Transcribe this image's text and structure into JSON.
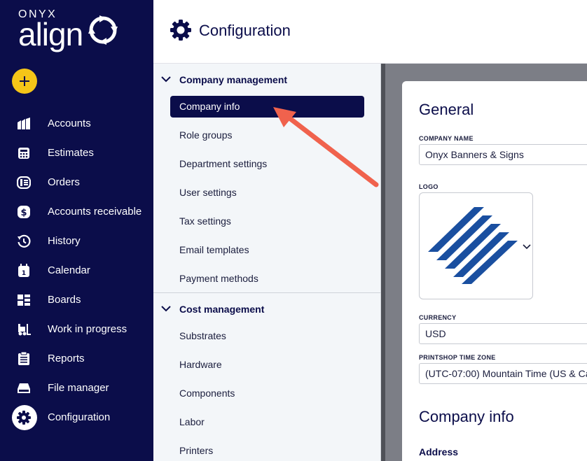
{
  "brand": {
    "onyx": "ONYX",
    "align": "align"
  },
  "sidebar": {
    "add_icon": "plus-icon",
    "items": [
      {
        "label": "Accounts",
        "icon": "accounts-icon"
      },
      {
        "label": "Estimates",
        "icon": "calculator-icon"
      },
      {
        "label": "Orders",
        "icon": "orders-icon"
      },
      {
        "label": "Accounts receivable",
        "icon": "dollar-icon"
      },
      {
        "label": "History",
        "icon": "history-icon"
      },
      {
        "label": "Calendar",
        "icon": "calendar-icon"
      },
      {
        "label": "Boards",
        "icon": "boards-icon"
      },
      {
        "label": "Work in progress",
        "icon": "forklift-icon"
      },
      {
        "label": "Reports",
        "icon": "clipboard-icon"
      },
      {
        "label": "File manager",
        "icon": "drive-icon"
      },
      {
        "label": "Configuration",
        "icon": "gear-icon",
        "active": true
      }
    ]
  },
  "header": {
    "title": "Configuration"
  },
  "subnav": {
    "sections": [
      {
        "label": "Company management",
        "items": [
          "Company info",
          "Role groups",
          "Department settings",
          "User settings",
          "Tax settings",
          "Email templates",
          "Payment methods"
        ]
      },
      {
        "label": "Cost management",
        "items": [
          "Substrates",
          "Hardware",
          "Components",
          "Labor",
          "Printers"
        ]
      }
    ],
    "active_item": "Company info"
  },
  "main": {
    "general_heading": "General",
    "company_name_label": "COMPANY NAME",
    "company_name_value": "Onyx Banners & Signs",
    "logo_label": "LOGO",
    "currency_label": "CURRENCY",
    "currency_value": "USD",
    "timezone_label": "PRINTSHOP TIME ZONE",
    "timezone_value": "(UTC-07:00) Mountain Time (US & Ca",
    "company_info_heading": "Company info",
    "address_label": "Address"
  },
  "colors": {
    "sidebar_bg": "#0b0d4a",
    "accent_yellow": "#f5c518",
    "arrow": "#f0624d",
    "logo_blue": "#1a4fa0"
  }
}
